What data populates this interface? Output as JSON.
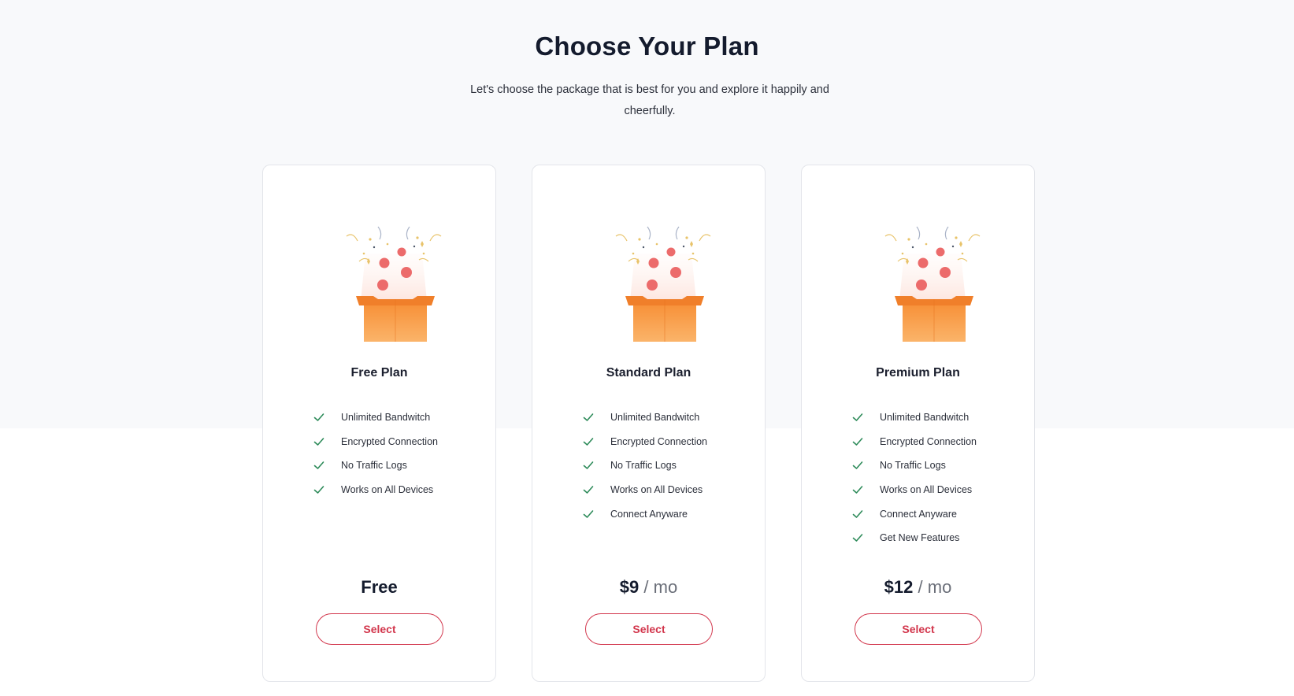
{
  "page": {
    "title": "Choose Your Plan",
    "subtitle": "Let's choose the package that is best for you and explore it happily and cheerfully."
  },
  "colors": {
    "accent": "#d2364c",
    "check": "#2e8b5a",
    "box_orange": "#f79a3b",
    "balloon": "#ec6b6b"
  },
  "icons": {
    "illustration": "gift-box-celebration-icon",
    "feature_check": "check-icon"
  },
  "plans": [
    {
      "name": "Free Plan",
      "features": [
        "Unlimited Bandwitch",
        "Encrypted Connection",
        "No Traffic Logs",
        "Works on All Devices"
      ],
      "price": "Free",
      "per": "",
      "button": "Select"
    },
    {
      "name": "Standard Plan",
      "features": [
        "Unlimited Bandwitch",
        "Encrypted Connection",
        "No Traffic Logs",
        "Works on All Devices",
        "Connect Anyware"
      ],
      "price": "$9",
      "per": "/ mo",
      "button": "Select"
    },
    {
      "name": "Premium Plan",
      "features": [
        "Unlimited Bandwitch",
        "Encrypted Connection",
        "No Traffic Logs",
        "Works on All Devices",
        "Connect Anyware",
        "Get New Features"
      ],
      "price": "$12",
      "per": "/ mo",
      "button": "Select"
    }
  ]
}
